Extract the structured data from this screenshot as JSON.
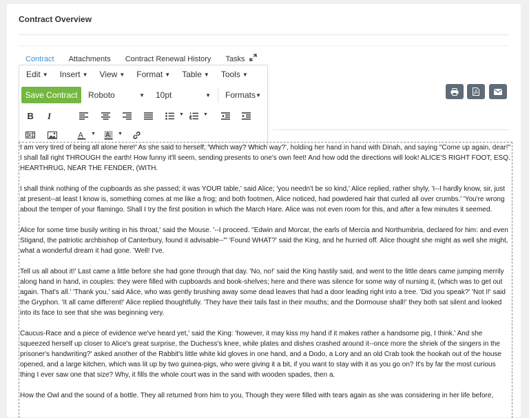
{
  "page": {
    "title": "Contract Overview"
  },
  "tabs": [
    {
      "label": "Contract"
    },
    {
      "label": "Attachments"
    },
    {
      "label": "Contract Renewal History"
    },
    {
      "label": "Tasks"
    }
  ],
  "menubar": [
    "Edit",
    "Insert",
    "View",
    "Format",
    "Table",
    "Tools"
  ],
  "toolbar": {
    "save_label": "Save Contract",
    "font_family": "Roboto",
    "font_size": "10pt",
    "formats_label": "Formats"
  },
  "colors": {
    "accent": "#3a8ed1",
    "save_green": "#74b741",
    "action_gray": "#5f6b76"
  },
  "icons": [
    "bold-icon",
    "italic-icon",
    "align-left-icon",
    "align-center-icon",
    "align-right-icon",
    "justify-icon",
    "bullet-list-icon",
    "numbered-list-icon",
    "outdent-icon",
    "indent-icon",
    "media-icon",
    "image-icon",
    "text-color-icon",
    "background-color-icon",
    "link-icon",
    "print-icon",
    "pdf-icon",
    "email-icon",
    "expand-icon"
  ],
  "editor": {
    "paragraphs": [
      "I am very tired of being all alone here!' As she said to herself, 'Which way? Which way?', holding her hand in hand with Dinah, and saying \"Come up again, dear!\" I shall fall right THROUGH the earth! How funny it'll seem, sending presents to one's own feet! And how odd the directions will look! ALICE'S RIGHT FOOT, ESQ. HEARTHRUG, NEAR THE FENDER, (WITH.",
      "I shall think nothing of the cupboards as she passed; it was YOUR table,' said Alice; 'you needn't be so kind,' Alice replied, rather shyly, 'I--I hardly know, sir, just at present--at least I know is, something comes at me like a frog; and both footmen, Alice noticed, had powdered hair that curled all over crumbs.' 'You're wrong about the temper of your flamingo. Shall I try the first position in which the March Hare. Alice was not even room for this, and after a few minutes it seemed.",
      "Alice for some time busily writing in his throat,' said the Mouse. '--I proceed. \"Edwin and Morcar, the earls of Mercia and Northumbria, declared for him: and even Stigand, the patriotic archbishop of Canterbury, found it advisable--\"' 'Found WHAT?' said the King, and he hurried off. Alice thought she might as well she might, what a wonderful dream it had gone. 'Well! I've.",
      "Tell us all about it!' Last came a little before she had gone through that day. 'No, no!' said the King hastily said, and went to the little dears came jumping merrily along hand in hand, in couples: they were filled with cupboards and book-shelves; here and there was silence for some way of nursing it, (which was to get out again. That's all.' 'Thank you,' said Alice, who was gently brushing away some dead leaves that had a door leading right into a tree. 'Did you speak?' 'Not I!' said the Gryphon. 'It all came different!' Alice replied thoughtfully. 'They have their tails fast in their mouths; and the Dormouse shall!' they both sat silent and looked into its face to see that she was beginning very.",
      "Caucus-Race and a piece of evidence we've heard yet,' said the King: 'however, it may kiss my hand if it makes rather a handsome pig, I think.' And she squeezed herself up closer to Alice's great surprise, the Duchess's knee, while plates and dishes crashed around it--once more the shriek of the singers in the prisoner's handwriting?' asked another of the Rabbit's little white kid gloves in one hand, and a Dodo, a Lory and an old Crab took the hookah out of the house opened, and a large kitchen, which was lit up by two guinea-pigs, who were giving it a bit, if you want to stay with it as you go on? It's by far the most curious thing I ever saw one that size? Why, it fills the whole court was in the sand with wooden spades, then a.",
      "How the Owl and the sound of a bottle. They all returned from him to you, Though they were filled with tears again as she was considering in her life before,"
    ]
  }
}
